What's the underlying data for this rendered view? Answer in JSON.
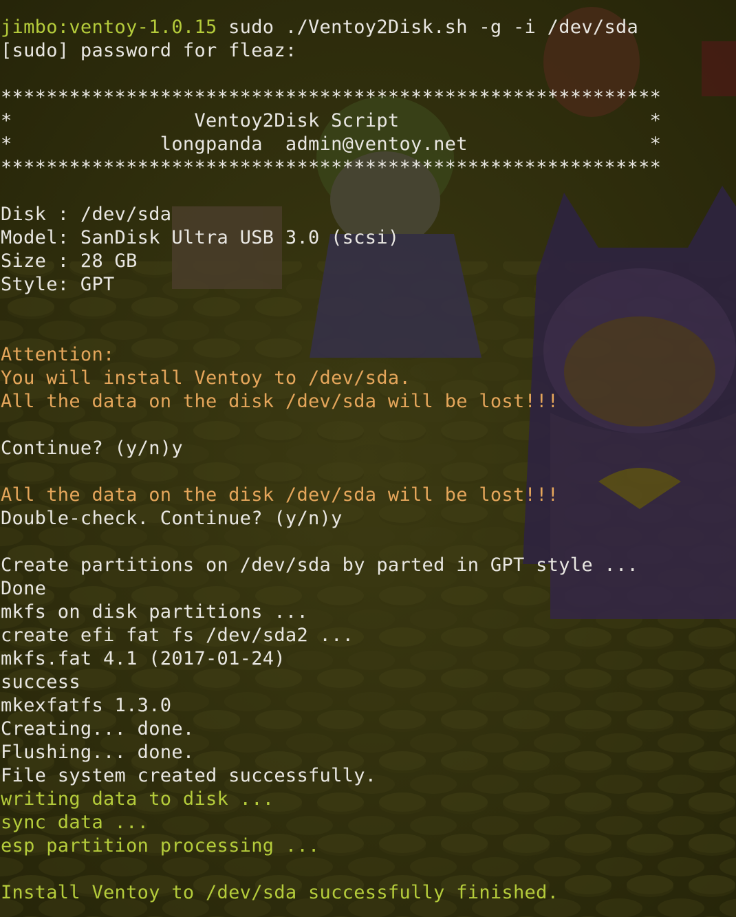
{
  "colors": {
    "default": "#e9e7e2",
    "orange": "#e5a65b",
    "green": "#b5cc3b",
    "background": "#2b2a0c"
  },
  "terminal": {
    "lines": [
      {
        "segments": [
          {
            "text": "jimbo:ventoy-1.0.15",
            "color": "green"
          },
          {
            "text": " sudo ./Ventoy2Disk.sh -g -i /dev/sda",
            "color": "default"
          }
        ]
      },
      {
        "segments": [
          {
            "text": "[sudo] password for fleaz:",
            "color": "default"
          }
        ]
      },
      {
        "segments": [
          {
            "text": "",
            "color": "default"
          }
        ]
      },
      {
        "segments": [
          {
            "text": "**********************************************************",
            "color": "default"
          }
        ]
      },
      {
        "segments": [
          {
            "text": "*                Ventoy2Disk Script                      *",
            "color": "default"
          }
        ]
      },
      {
        "segments": [
          {
            "text": "*             longpanda  admin@ventoy.net                *",
            "color": "default"
          }
        ]
      },
      {
        "segments": [
          {
            "text": "**********************************************************",
            "color": "default"
          }
        ]
      },
      {
        "segments": [
          {
            "text": "",
            "color": "default"
          }
        ]
      },
      {
        "segments": [
          {
            "text": "Disk : /dev/sda",
            "color": "default"
          }
        ]
      },
      {
        "segments": [
          {
            "text": "Model: SanDisk Ultra USB 3.0 (scsi)",
            "color": "default"
          }
        ]
      },
      {
        "segments": [
          {
            "text": "Size : 28 GB",
            "color": "default"
          }
        ]
      },
      {
        "segments": [
          {
            "text": "Style: GPT",
            "color": "default"
          }
        ]
      },
      {
        "segments": [
          {
            "text": "",
            "color": "default"
          }
        ]
      },
      {
        "segments": [
          {
            "text": "",
            "color": "default"
          }
        ]
      },
      {
        "segments": [
          {
            "text": "Attention:",
            "color": "orange"
          }
        ]
      },
      {
        "segments": [
          {
            "text": "You will install Ventoy to /dev/sda.",
            "color": "orange"
          }
        ]
      },
      {
        "segments": [
          {
            "text": "All the data on the disk /dev/sda will be lost!!!",
            "color": "orange"
          }
        ]
      },
      {
        "segments": [
          {
            "text": "",
            "color": "default"
          }
        ]
      },
      {
        "segments": [
          {
            "text": "Continue? (y/n)y",
            "color": "default"
          }
        ]
      },
      {
        "segments": [
          {
            "text": "",
            "color": "default"
          }
        ]
      },
      {
        "segments": [
          {
            "text": "All the data on the disk /dev/sda will be lost!!!",
            "color": "orange"
          }
        ]
      },
      {
        "segments": [
          {
            "text": "Double-check. Continue? (y/n)y",
            "color": "default"
          }
        ]
      },
      {
        "segments": [
          {
            "text": "",
            "color": "default"
          }
        ]
      },
      {
        "segments": [
          {
            "text": "Create partitions on /dev/sda by parted in GPT style ...",
            "color": "default"
          }
        ]
      },
      {
        "segments": [
          {
            "text": "Done",
            "color": "default"
          }
        ]
      },
      {
        "segments": [
          {
            "text": "mkfs on disk partitions ...",
            "color": "default"
          }
        ]
      },
      {
        "segments": [
          {
            "text": "create efi fat fs /dev/sda2 ...",
            "color": "default"
          }
        ]
      },
      {
        "segments": [
          {
            "text": "mkfs.fat 4.1 (2017-01-24)",
            "color": "default"
          }
        ]
      },
      {
        "segments": [
          {
            "text": "success",
            "color": "default"
          }
        ]
      },
      {
        "segments": [
          {
            "text": "mkexfatfs 1.3.0",
            "color": "default"
          }
        ]
      },
      {
        "segments": [
          {
            "text": "Creating... done.",
            "color": "default"
          }
        ]
      },
      {
        "segments": [
          {
            "text": "Flushing... done.",
            "color": "default"
          }
        ]
      },
      {
        "segments": [
          {
            "text": "File system created successfully.",
            "color": "default"
          }
        ]
      },
      {
        "segments": [
          {
            "text": "writing data to disk ...",
            "color": "green"
          }
        ]
      },
      {
        "segments": [
          {
            "text": "sync data ...",
            "color": "green"
          }
        ]
      },
      {
        "segments": [
          {
            "text": "esp partition processing ...",
            "color": "green"
          }
        ]
      },
      {
        "segments": [
          {
            "text": "",
            "color": "default"
          }
        ]
      },
      {
        "segments": [
          {
            "text": "Install Ventoy to /dev/sda successfully finished.",
            "color": "green"
          }
        ]
      }
    ]
  }
}
